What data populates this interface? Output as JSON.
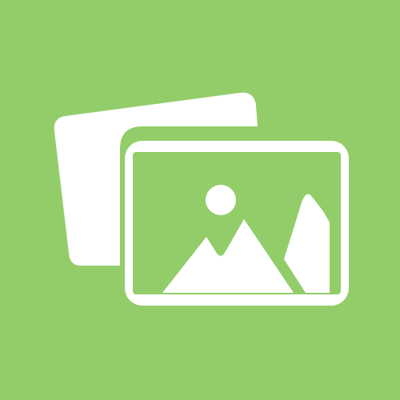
{
  "icon": {
    "name": "photo-gallery-icon",
    "colors": {
      "background": "#93CD6A",
      "foreground": "#FFFFFF"
    }
  }
}
